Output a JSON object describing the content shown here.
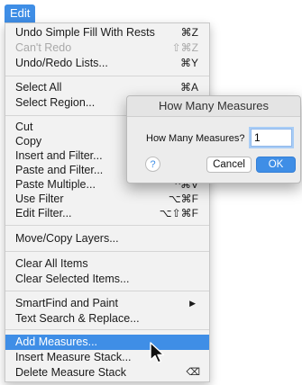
{
  "menubar": {
    "title": "Edit"
  },
  "menu": {
    "items": [
      {
        "label": "Undo Simple Fill With Rests",
        "shortcut": "⌘Z"
      },
      {
        "label": "Can't Redo",
        "shortcut": "⇧⌘Z"
      },
      {
        "label": "Undo/Redo Lists...",
        "shortcut": "⌘Y"
      },
      {
        "label": "Select All",
        "shortcut": "⌘A"
      },
      {
        "label": "Select Region..."
      },
      {
        "label": "Cut"
      },
      {
        "label": "Copy"
      },
      {
        "label": "Insert and Filter..."
      },
      {
        "label": "Paste and Filter..."
      },
      {
        "label": "Paste Multiple...",
        "shortcut": "^⌘V"
      },
      {
        "label": "Use Filter",
        "shortcut": "⌥⌘F"
      },
      {
        "label": "Edit Filter...",
        "shortcut": "⌥⇧⌘F"
      },
      {
        "label": "Move/Copy Layers..."
      },
      {
        "label": "Clear All Items"
      },
      {
        "label": "Clear Selected Items..."
      },
      {
        "label": "SmartFind and Paint",
        "arrow": "▶"
      },
      {
        "label": "Text Search & Replace..."
      },
      {
        "label": "Add Measures..."
      },
      {
        "label": "Insert Measure Stack..."
      },
      {
        "label": "Delete Measure Stack",
        "shortcut": "⌫"
      }
    ]
  },
  "dialog": {
    "title": "How Many Measures",
    "field_label": "How Many Measures?",
    "field_value": "1",
    "help": "?",
    "cancel_label": "Cancel",
    "ok_label": "OK"
  },
  "colors": {
    "accent": "#3f8ee6",
    "menu_bg": "#f2f2f2",
    "disabled": "#a9a9a9"
  },
  "icons": {
    "cursor": "arrow-pointer-icon",
    "help": "help-icon",
    "submenu": "submenu-arrow-icon",
    "delete": "delete-icon"
  }
}
